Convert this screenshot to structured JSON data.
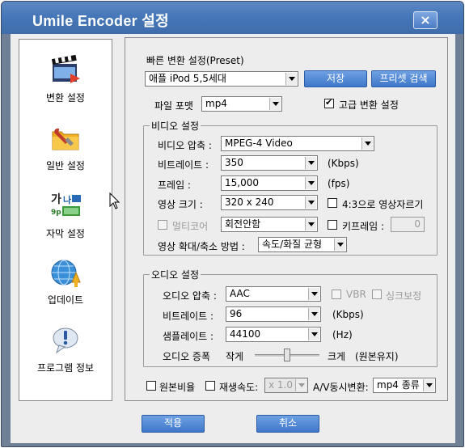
{
  "window": {
    "title": "Umile Encoder 설정",
    "close_label": "×"
  },
  "sidebar": {
    "items": [
      {
        "label": "변환 설정",
        "icon": "film-clapper-icon"
      },
      {
        "label": "일반 설정",
        "icon": "wrench-folder-icon"
      },
      {
        "label": "자막 설정",
        "icon": "subtitle-ga-na-icon"
      },
      {
        "label": "업데이트",
        "icon": "globe-update-icon"
      },
      {
        "label": "프로그램 정보",
        "icon": "info-bubble-icon"
      }
    ]
  },
  "preset": {
    "label": "빠른 변환 설정(Preset)",
    "value": "애플 iPod 5,5세대",
    "save_label": "저장",
    "search_label": "프리셋 검색"
  },
  "format": {
    "label": "파일 포맷",
    "value": "mp4",
    "advanced_label": "고급 변환 설정",
    "advanced_checked": true
  },
  "video": {
    "group_label": "비디오 설정",
    "codec_label": "비디오 압축 :",
    "codec_value": "MPEG-4 Video",
    "bitrate_label": "비트레이트 :",
    "bitrate_value": "350",
    "bitrate_unit": "(Kbps)",
    "frame_label": "프레임 :",
    "frame_value": "15,000",
    "frame_unit": "(fps)",
    "size_label": "영상 크기 :",
    "size_value": "320 x 240",
    "crop_label": "4:3으로 영상자르기",
    "multicore_label": "멀티코어",
    "rotate_value": "회전안함",
    "keyframe_label": "키프레임 :",
    "keyframe_value": "0",
    "scale_label": "영상 확대/축소 방법 :",
    "scale_value": "속도/화질 균형"
  },
  "audio": {
    "group_label": "오디오 설정",
    "codec_label": "오디오 압축 :",
    "codec_value": "AAC",
    "vbr_label": "VBR",
    "sync_label": "싱크보정",
    "bitrate_label": "비트레이트 :",
    "bitrate_value": "96",
    "bitrate_unit": "(Kbps)",
    "samplerate_label": "샘플레이트 :",
    "samplerate_value": "44100",
    "samplerate_unit": "(Hz)",
    "boost_label": "오디오 증폭",
    "boost_min_label": "작게",
    "boost_max_label": "크게",
    "boost_note": "(원본유지)",
    "boost_level_fraction": 0.5
  },
  "bottom": {
    "original_ratio_label": "원본비율",
    "playback_speed_label": "재생속도:",
    "playback_speed_value": "x 1.0",
    "av_sync_label": "A/V동시변환:",
    "av_sync_value": "mp4 종류"
  },
  "footer": {
    "apply_label": "적용",
    "cancel_label": "취소"
  },
  "colors": {
    "title_bar": "#4677b8",
    "button_blue": "#3f77c9",
    "frame": "#6f7f96"
  }
}
